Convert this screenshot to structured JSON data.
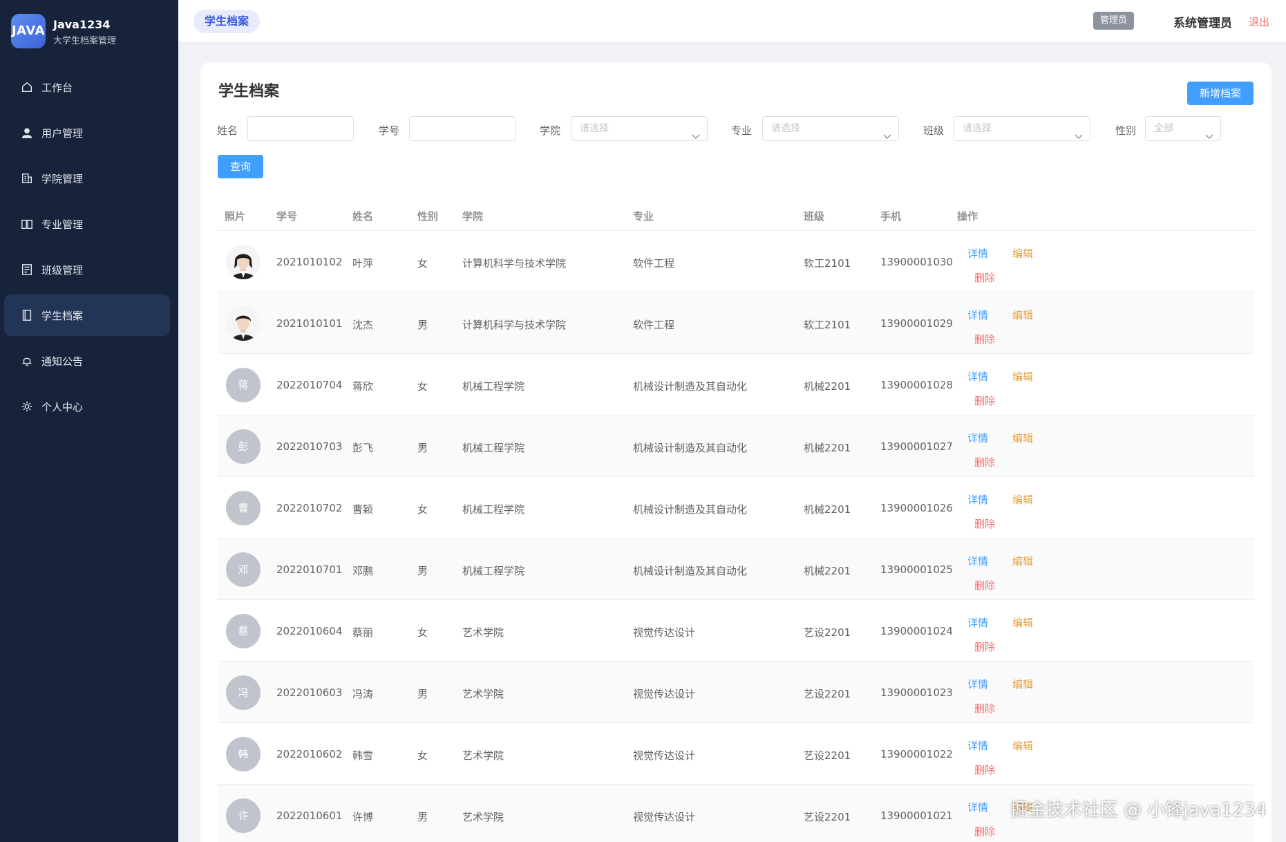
{
  "brand": {
    "logo_text": "JAVA",
    "title": "Java1234",
    "subtitle": "大学生档案管理"
  },
  "sidebar": {
    "items": [
      {
        "label": "工作台",
        "icon": "home-icon",
        "active": false
      },
      {
        "label": "用户管理",
        "icon": "user-icon",
        "active": false
      },
      {
        "label": "学院管理",
        "icon": "building-icon",
        "active": false
      },
      {
        "label": "专业管理",
        "icon": "book-icon",
        "active": false
      },
      {
        "label": "班级管理",
        "icon": "class-icon",
        "active": false
      },
      {
        "label": "学生档案",
        "icon": "notebook-icon",
        "active": true
      },
      {
        "label": "通知公告",
        "icon": "bell-icon",
        "active": false
      },
      {
        "label": "个人中心",
        "icon": "gear-icon",
        "active": false
      }
    ]
  },
  "header": {
    "tab": "学生档案",
    "role": "管理员",
    "user": "系统管理员",
    "logout": "退出"
  },
  "main": {
    "title": "学生档案",
    "add_button": "新增档案",
    "query_button": "查询",
    "filters": {
      "name_label": "姓名",
      "id_label": "学号",
      "college_label": "学院",
      "college_placeholder": "请选择",
      "major_label": "专业",
      "major_placeholder": "请选择",
      "class_label": "班级",
      "class_placeholder": "请选择",
      "gender_label": "性别",
      "gender_value": "全部"
    },
    "columns": [
      "照片",
      "学号",
      "姓名",
      "性别",
      "学院",
      "专业",
      "班级",
      "手机",
      "操作"
    ],
    "actions": {
      "detail": "详情",
      "edit": "编辑",
      "delete": "删除"
    },
    "rows": [
      {
        "avatar": "",
        "photo": true,
        "id": "2021010102",
        "name": "叶萍",
        "gender": "女",
        "college": "计算机科学与技术学院",
        "major": "软件工程",
        "class": "软工2101",
        "phone": "13900001030"
      },
      {
        "avatar": "",
        "photo": true,
        "id": "2021010101",
        "name": "沈杰",
        "gender": "男",
        "college": "计算机科学与技术学院",
        "major": "软件工程",
        "class": "软工2101",
        "phone": "13900001029"
      },
      {
        "avatar": "蒋",
        "photo": false,
        "id": "2022010704",
        "name": "蒋欣",
        "gender": "女",
        "college": "机械工程学院",
        "major": "机械设计制造及其自动化",
        "class": "机械2201",
        "phone": "13900001028"
      },
      {
        "avatar": "彭",
        "photo": false,
        "id": "2022010703",
        "name": "彭飞",
        "gender": "男",
        "college": "机械工程学院",
        "major": "机械设计制造及其自动化",
        "class": "机械2201",
        "phone": "13900001027"
      },
      {
        "avatar": "曹",
        "photo": false,
        "id": "2022010702",
        "name": "曹颖",
        "gender": "女",
        "college": "机械工程学院",
        "major": "机械设计制造及其自动化",
        "class": "机械2201",
        "phone": "13900001026"
      },
      {
        "avatar": "邓",
        "photo": false,
        "id": "2022010701",
        "name": "邓鹏",
        "gender": "男",
        "college": "机械工程学院",
        "major": "机械设计制造及其自动化",
        "class": "机械2201",
        "phone": "13900001025"
      },
      {
        "avatar": "蔡",
        "photo": false,
        "id": "2022010604",
        "name": "蔡丽",
        "gender": "女",
        "college": "艺术学院",
        "major": "视觉传达设计",
        "class": "艺设2201",
        "phone": "13900001024"
      },
      {
        "avatar": "冯",
        "photo": false,
        "id": "2022010603",
        "name": "冯涛",
        "gender": "男",
        "college": "艺术学院",
        "major": "视觉传达设计",
        "class": "艺设2201",
        "phone": "13900001023"
      },
      {
        "avatar": "韩",
        "photo": false,
        "id": "2022010602",
        "name": "韩雪",
        "gender": "女",
        "college": "艺术学院",
        "major": "视觉传达设计",
        "class": "艺设2201",
        "phone": "13900001022"
      },
      {
        "avatar": "许",
        "photo": false,
        "id": "2022010601",
        "name": "许博",
        "gender": "男",
        "college": "艺术学院",
        "major": "视觉传达设计",
        "class": "艺设2201",
        "phone": "13900001021"
      }
    ]
  },
  "watermark": "掘金技术社区 @ 小锋java1234",
  "colors": {
    "sidebar_bg": "#17233a",
    "sidebar_active": "#233556",
    "primary": "#409eff",
    "warning": "#e6a23c",
    "danger": "#f56c6c"
  }
}
